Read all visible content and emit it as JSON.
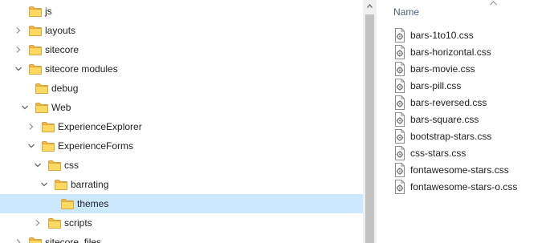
{
  "tree": {
    "items": [
      {
        "label": "js",
        "expander": "none",
        "selected": false
      },
      {
        "label": "layouts",
        "expander": "collapsed",
        "selected": false
      },
      {
        "label": "sitecore",
        "expander": "collapsed",
        "selected": false
      },
      {
        "label": "sitecore modules",
        "expander": "expanded",
        "selected": false
      },
      {
        "label": "debug",
        "expander": "none",
        "selected": false
      },
      {
        "label": "Web",
        "expander": "expanded",
        "selected": false
      },
      {
        "label": "ExperienceExplorer",
        "expander": "collapsed",
        "selected": false
      },
      {
        "label": "ExperienceForms",
        "expander": "expanded",
        "selected": false
      },
      {
        "label": "css",
        "expander": "expanded",
        "selected": false
      },
      {
        "label": "barrating",
        "expander": "expanded",
        "selected": false
      },
      {
        "label": "themes",
        "expander": "none",
        "selected": true
      },
      {
        "label": "scripts",
        "expander": "collapsed",
        "selected": false
      },
      {
        "label": "sitecore_files",
        "expander": "collapsed",
        "selected": false
      }
    ]
  },
  "file_list": {
    "column_name": "Name",
    "sort": "ascending",
    "files": [
      {
        "name": "bars-1to10.css",
        "icon": "css-file-icon"
      },
      {
        "name": "bars-horizontal.css",
        "icon": "css-file-icon"
      },
      {
        "name": "bars-movie.css",
        "icon": "css-file-icon"
      },
      {
        "name": "bars-pill.css",
        "icon": "css-file-icon"
      },
      {
        "name": "bars-reversed.css",
        "icon": "css-file-icon"
      },
      {
        "name": "bars-square.css",
        "icon": "css-file-icon"
      },
      {
        "name": "bootstrap-stars.css",
        "icon": "css-file-icon"
      },
      {
        "name": "css-stars.css",
        "icon": "css-file-icon"
      },
      {
        "name": "fontawesome-stars.css",
        "icon": "css-file-icon"
      },
      {
        "name": "fontawesome-stars-o.css",
        "icon": "css-file-icon"
      }
    ]
  },
  "colors": {
    "selection": "#cce8ff",
    "folder": "#ffd862",
    "header_text": "#4c607a"
  }
}
